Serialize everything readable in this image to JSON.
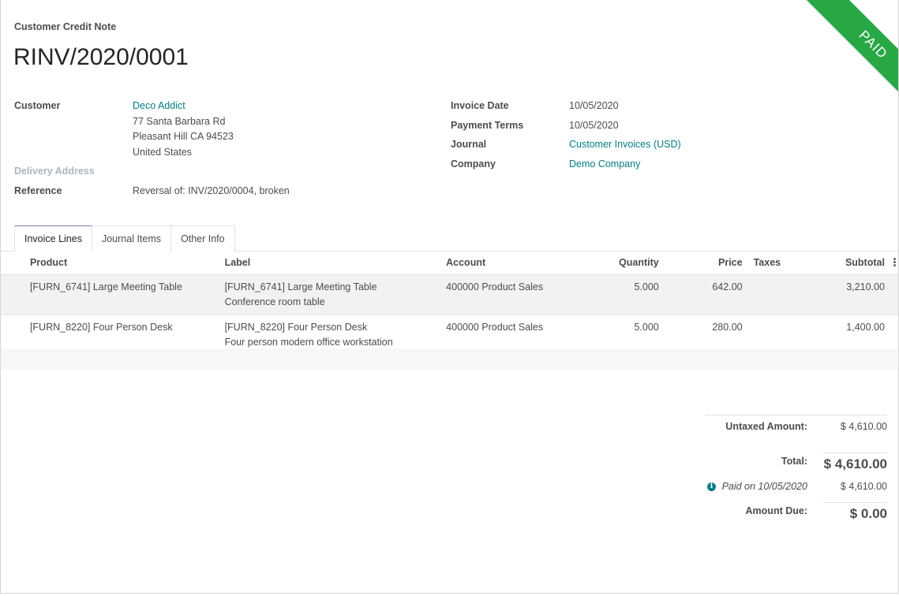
{
  "header": {
    "doc_type": "Customer Credit Note",
    "title": "RINV/2020/0001",
    "ribbon": "PAID"
  },
  "left_fields": {
    "customer_label": "Customer",
    "customer_name": "Deco Addict",
    "address_1": "77 Santa Barbara Rd",
    "address_2": "Pleasant Hill CA 94523",
    "address_3": "United States",
    "delivery_label": "Delivery Address",
    "reference_label": "Reference",
    "reference_value": "Reversal of: INV/2020/0004, broken"
  },
  "right_fields": {
    "invoice_date_label": "Invoice Date",
    "invoice_date": "10/05/2020",
    "payment_terms_label": "Payment Terms",
    "payment_terms": "10/05/2020",
    "journal_label": "Journal",
    "journal": "Customer Invoices (USD)",
    "company_label": "Company",
    "company": "Demo Company"
  },
  "tabs": [
    "Invoice Lines",
    "Journal Items",
    "Other Info"
  ],
  "table": {
    "columns": [
      "Product",
      "Label",
      "Account",
      "Quantity",
      "Price",
      "Taxes",
      "Subtotal"
    ],
    "rows": [
      {
        "product": "[FURN_6741] Large Meeting Table",
        "label_1": "[FURN_6741] Large Meeting Table",
        "label_2": "Conference room table",
        "account": "400000 Product Sales",
        "quantity": "5.000",
        "price": "642.00",
        "taxes": "",
        "subtotal": "3,210.00"
      },
      {
        "product": "[FURN_8220] Four Person Desk",
        "label_1": "[FURN_8220] Four Person Desk",
        "label_2": "Four person modern office workstation",
        "account": "400000 Product Sales",
        "quantity": "5.000",
        "price": "280.00",
        "taxes": "",
        "subtotal": "1,400.00"
      }
    ]
  },
  "totals": {
    "untaxed_label": "Untaxed Amount:",
    "untaxed_value": "$ 4,610.00",
    "total_label": "Total:",
    "total_value": "$ 4,610.00",
    "paid_note": "Paid on 10/05/2020",
    "paid_value": "$ 4,610.00",
    "due_label": "Amount Due:",
    "due_value": "$ 0.00"
  },
  "colors": {
    "ribbon": "#28a745",
    "link": "#017e84",
    "active_tab_top": "#7c7bad"
  }
}
